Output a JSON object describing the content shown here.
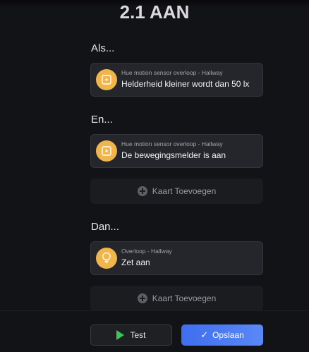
{
  "header": {
    "title": "2.1 AAN"
  },
  "sections": {
    "if": {
      "title": "Als..."
    },
    "and": {
      "title": "En..."
    },
    "then": {
      "title": "Dan..."
    }
  },
  "cards": {
    "if_card": {
      "subtitle": "Hue motion sensor overloop - Hallway",
      "text": "Helderheid kleiner wordt dan 50 lx",
      "icon": "motion-sensor-icon"
    },
    "and_card": {
      "subtitle": "Hue motion sensor overloop - Hallway",
      "text": "De bewegingsmelder is aan",
      "icon": "motion-sensor-icon"
    },
    "then_card": {
      "subtitle": "Overloop - Hallway",
      "text": "Zet aan",
      "icon": "lightbulb-icon"
    }
  },
  "add_card_label": "Kaart Toevoegen",
  "buttons": {
    "test_label": "Test",
    "save_label": "Opslaan"
  },
  "colors": {
    "background": "#121317",
    "card": "#25262b",
    "icon_badge": "#f0b54b",
    "save_button": "#4a7bf3",
    "play_icon": "#38c75a"
  }
}
